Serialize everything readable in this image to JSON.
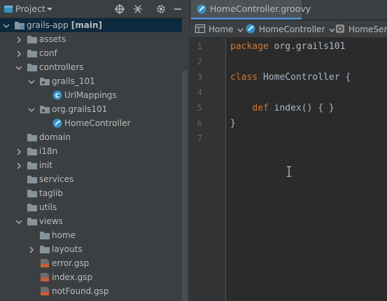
{
  "project_panel": {
    "title": "Project",
    "tree": [
      {
        "label": "grails-app",
        "suffix": "[main]",
        "depth": 0,
        "expanded": true,
        "type": "module",
        "selected": true
      },
      {
        "label": "assets",
        "depth": 1,
        "expanded": false,
        "type": "folder"
      },
      {
        "label": "conf",
        "depth": 1,
        "expanded": false,
        "type": "folder"
      },
      {
        "label": "controllers",
        "depth": 1,
        "expanded": true,
        "type": "folder"
      },
      {
        "label": "grails_101",
        "depth": 2,
        "expanded": true,
        "type": "package"
      },
      {
        "label": "UrlMappings",
        "depth": 3,
        "type": "class"
      },
      {
        "label": "org.grails101",
        "depth": 2,
        "expanded": true,
        "type": "package"
      },
      {
        "label": "HomeController",
        "depth": 3,
        "type": "groovy"
      },
      {
        "label": "domain",
        "depth": 1,
        "type": "folder"
      },
      {
        "label": "i18n",
        "depth": 1,
        "expanded": false,
        "type": "folder"
      },
      {
        "label": "init",
        "depth": 1,
        "expanded": false,
        "type": "folder"
      },
      {
        "label": "services",
        "depth": 1,
        "type": "folder"
      },
      {
        "label": "taglib",
        "depth": 1,
        "type": "folder"
      },
      {
        "label": "utils",
        "depth": 1,
        "type": "folder"
      },
      {
        "label": "views",
        "depth": 1,
        "expanded": true,
        "type": "folder"
      },
      {
        "label": "home",
        "depth": 2,
        "type": "folder"
      },
      {
        "label": "layouts",
        "depth": 2,
        "expanded": false,
        "type": "folder"
      },
      {
        "label": "error.gsp",
        "depth": 2,
        "type": "gsp"
      },
      {
        "label": "index.gsp",
        "depth": 2,
        "type": "gsp"
      },
      {
        "label": "notFound.gsp",
        "depth": 2,
        "type": "gsp"
      }
    ]
  },
  "editor": {
    "tab": "HomeController.groovy",
    "breadcrumbs": [
      "Home",
      "HomeController",
      "HomeServic"
    ],
    "lines": [
      {
        "n": "1",
        "parts": [
          {
            "t": "package",
            "k": true
          },
          {
            "t": " org.grails101",
            "k": false
          }
        ]
      },
      {
        "n": "2",
        "parts": []
      },
      {
        "n": "3",
        "parts": [
          {
            "t": "class",
            "k": true
          },
          {
            "t": " HomeController {",
            "k": false
          }
        ]
      },
      {
        "n": "4",
        "parts": []
      },
      {
        "n": "5",
        "parts": [
          {
            "t": "    ",
            "k": false
          },
          {
            "t": "def",
            "k": true
          },
          {
            "t": " index() { }",
            "k": false
          }
        ]
      },
      {
        "n": "6",
        "parts": [
          {
            "t": "}",
            "k": false
          }
        ]
      },
      {
        "n": "7",
        "parts": []
      }
    ]
  },
  "colors": {
    "keyword": "#cc7832",
    "text": "#a9b7c6",
    "accent": "#4a88c7",
    "selection": "#0d293e",
    "folder": "#87939a",
    "groovy_badge": "#3592c4",
    "gsp_badge": "#c95d38"
  }
}
